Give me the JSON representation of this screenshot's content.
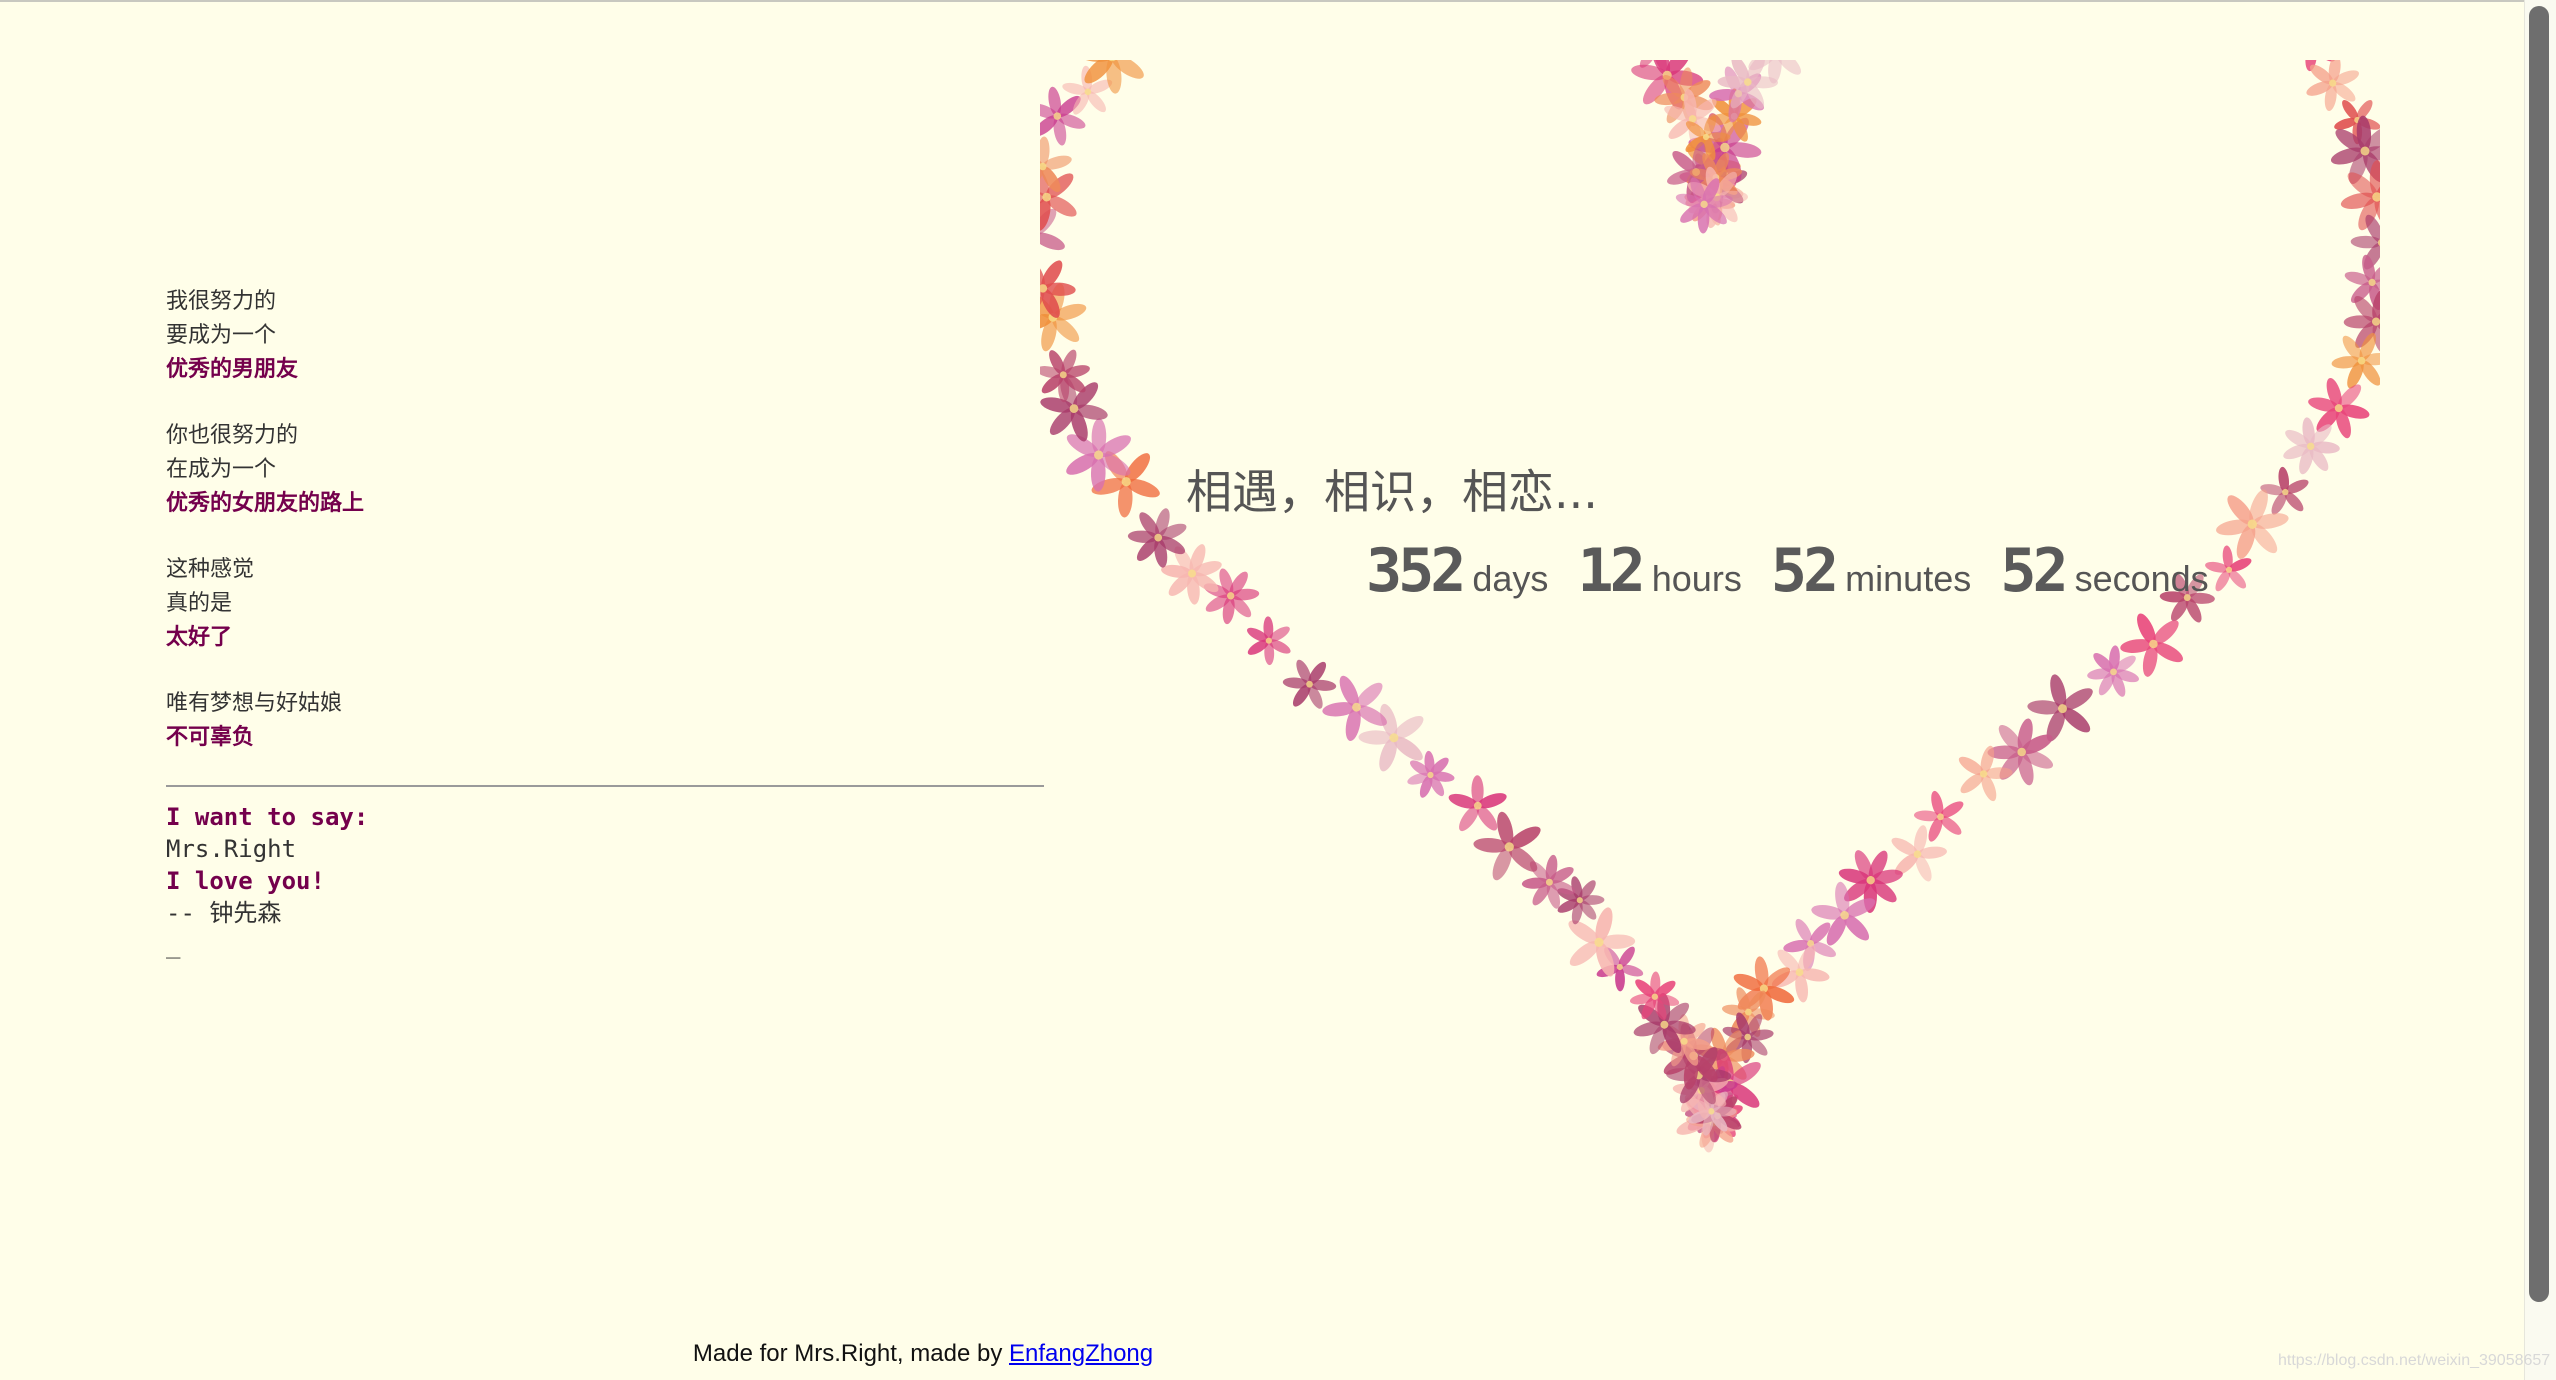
{
  "poem": {
    "stanzas": [
      {
        "lines": [
          {
            "text": "我很努力的",
            "em": false
          },
          {
            "text": "要成为一个",
            "em": false
          },
          {
            "text": "优秀的男朋友",
            "em": true
          }
        ]
      },
      {
        "lines": [
          {
            "text": "你也很努力的",
            "em": false
          },
          {
            "text": "在成为一个",
            "em": false
          },
          {
            "text": "优秀的女朋友的路上",
            "em": true
          }
        ]
      },
      {
        "lines": [
          {
            "text": "这种感觉",
            "em": false
          },
          {
            "text": "真的是",
            "em": false
          },
          {
            "text": "太好了",
            "em": true
          }
        ]
      },
      {
        "lines": [
          {
            "text": "唯有梦想与好姑娘",
            "em": false
          },
          {
            "text": "不可辜负",
            "em": true
          }
        ]
      }
    ]
  },
  "message": {
    "lines": [
      {
        "text": "I want to say:",
        "em": true
      },
      {
        "text": "Mrs.Right",
        "em": false
      },
      {
        "text": "I love you!",
        "em": true
      },
      {
        "text": "-- 钟先森",
        "em": false
      },
      {
        "text": "_",
        "em": false
      }
    ]
  },
  "heart": {
    "heading": "相遇，相识，相恋...",
    "counter": {
      "days": "352",
      "days_label": "days",
      "hours": "12",
      "hours_label": "hours",
      "minutes": "52",
      "minutes_label": "minutes",
      "seconds": "52",
      "seconds_label": "seconds"
    },
    "flower_colors": [
      "#e8457a",
      "#f06a3c",
      "#d9367a",
      "#f5a08a",
      "#c93a8e",
      "#ee8a5a",
      "#b8426a",
      "#f7b6b0",
      "#e04e4e",
      "#d870b0",
      "#f0903a",
      "#c85c8a",
      "#e9b9c4",
      "#a83a6a"
    ]
  },
  "footer": {
    "text": "Made for Mrs.Right, made by ",
    "link_text": "EnfangZhong"
  },
  "watermark": "https://blog.csdn.net/weixin_39058657"
}
